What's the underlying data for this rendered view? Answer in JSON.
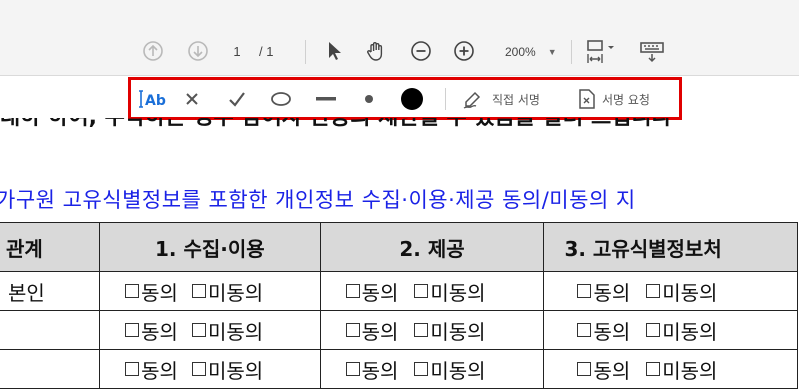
{
  "toolbar": {
    "page_current": "1",
    "page_separator": "/",
    "page_total": "1",
    "zoom": "200%"
  },
  "fill_sign": {
    "sign_yourself": "직접 서명",
    "request_signatures": "서명 요청"
  },
  "document": {
    "cut_line": "대하 하여, 수락하는 경우 참여자 관등의 제한될 수 있음을 알려 드립니다",
    "section_heading": "가구원 고유식별정보를 포함한 개인정보 수집·이용·제공 동의/미동의 지",
    "table": {
      "headers": [
        "관계",
        "1. 수집·이용",
        "2. 제공",
        "3. 고유식별정보처"
      ],
      "agree": "동의",
      "disagree": "미동의",
      "rows": [
        {
          "relation": "본인"
        },
        {
          "relation": ""
        },
        {
          "relation": ""
        }
      ]
    }
  },
  "colors": {
    "highlight_border": "#e00000",
    "heading_blue": "#1a22e6",
    "header_fill": "#d9d9d9"
  }
}
